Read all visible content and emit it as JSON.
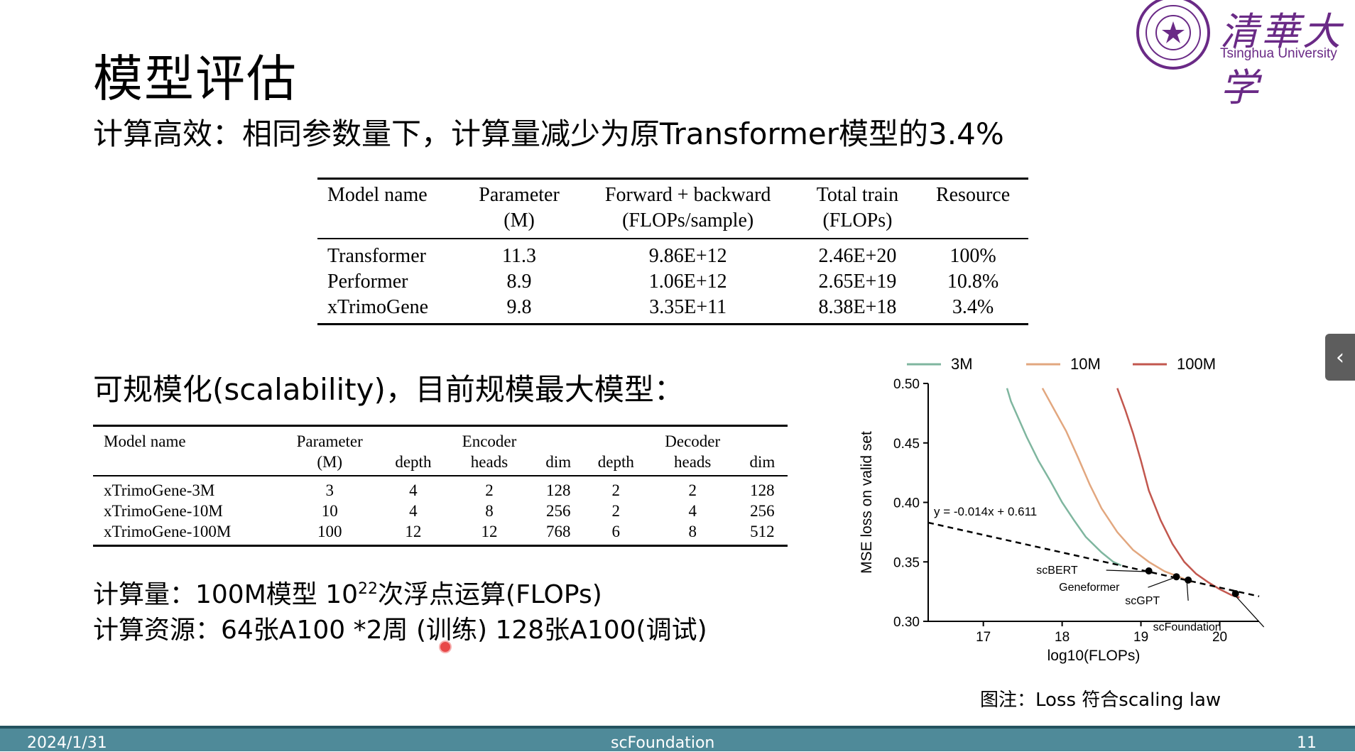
{
  "title": "模型评估",
  "subtitle": "计算高效：相同参数量下，计算量减少为原Transformer模型的3.4%",
  "section2": "可规模化(scalability)，目前规模最大模型：",
  "bullets": {
    "line1_prefix": "计算量：100M模型 10",
    "line1_sup": "22",
    "line1_suffix": "次浮点运算(FLOPs)",
    "line2": "计算资源：64张A100 *2周 (训练)   128张A100(调试)"
  },
  "logo": {
    "cn": "清華大学",
    "en": "Tsinghua University"
  },
  "table1": {
    "headers": [
      [
        "Model name",
        ""
      ],
      [
        "Parameter",
        "(M)"
      ],
      [
        "Forward + backward",
        "(FLOPs/sample)"
      ],
      [
        "Total train",
        "(FLOPs)"
      ],
      [
        "Resource",
        ""
      ]
    ],
    "rows": [
      [
        "Transformer",
        "11.3",
        "9.86E+12",
        "2.46E+20",
        "100%"
      ],
      [
        "Performer",
        "8.9",
        "1.06E+12",
        "2.65E+19",
        "10.8%"
      ],
      [
        "xTrimoGene",
        "9.8",
        "3.35E+11",
        "8.38E+18",
        "3.4%"
      ]
    ]
  },
  "table2": {
    "header_row1": [
      "Model name",
      "Parameter",
      "",
      "Encoder",
      "",
      "",
      "Decoder",
      ""
    ],
    "header_row2": [
      "",
      "(M)",
      "depth",
      "heads",
      "dim",
      "depth",
      "heads",
      "dim"
    ],
    "rows": [
      [
        "xTrimoGene-3M",
        "3",
        "4",
        "2",
        "128",
        "2",
        "2",
        "128"
      ],
      [
        "xTrimoGene-10M",
        "10",
        "4",
        "8",
        "256",
        "2",
        "4",
        "256"
      ],
      [
        "xTrimoGene-100M",
        "100",
        "12",
        "12",
        "768",
        "6",
        "8",
        "512"
      ]
    ]
  },
  "chart_data": {
    "type": "line",
    "xlabel": "log10(FLOPs)",
    "ylabel": "MSE loss on valid set",
    "xlim": [
      16.3,
      20.5
    ],
    "ylim": [
      0.3,
      0.5
    ],
    "xticks": [
      "17",
      "18",
      "19",
      "20"
    ],
    "yticks": [
      "0.30",
      "0.35",
      "0.40",
      "0.45",
      "0.50"
    ],
    "legend_position": "top",
    "series": [
      {
        "name": "3M",
        "color": "#7fb69f",
        "x": [
          17.3,
          17.35,
          17.45,
          17.55,
          17.7,
          17.85,
          18.0,
          18.15,
          18.3,
          18.5,
          18.65,
          18.75
        ],
        "y": [
          0.496,
          0.485,
          0.47,
          0.455,
          0.435,
          0.418,
          0.4,
          0.385,
          0.371,
          0.358,
          0.35,
          0.347
        ]
      },
      {
        "name": "10M",
        "color": "#e2a77f",
        "x": [
          17.75,
          17.9,
          18.05,
          18.2,
          18.35,
          18.5,
          18.7,
          18.9,
          19.1,
          19.3,
          19.5,
          19.65
        ],
        "y": [
          0.496,
          0.478,
          0.46,
          0.438,
          0.415,
          0.395,
          0.375,
          0.36,
          0.35,
          0.342,
          0.337,
          0.333
        ]
      },
      {
        "name": "100M",
        "color": "#c2574e",
        "x": [
          18.7,
          18.8,
          18.9,
          19.0,
          19.1,
          19.25,
          19.4,
          19.55,
          19.7,
          19.85,
          20.0,
          20.15,
          20.25
        ],
        "y": [
          0.496,
          0.478,
          0.458,
          0.435,
          0.41,
          0.385,
          0.365,
          0.35,
          0.34,
          0.333,
          0.327,
          0.322,
          0.32
        ]
      }
    ],
    "fit_line": {
      "label": "y = -0.014x + 0.611",
      "x": [
        16.3,
        20.5
      ],
      "y": [
        0.383,
        0.321
      ]
    },
    "points": [
      {
        "label": "scBERT",
        "x": 19.1,
        "y": 0.3424
      },
      {
        "label": "Geneformer",
        "x": 19.45,
        "y": 0.3375
      },
      {
        "label": "scGPT",
        "x": 19.6,
        "y": 0.3347
      },
      {
        "label": "scFoundation",
        "x": 20.2,
        "y": 0.3233
      }
    ]
  },
  "caption": "图注：Loss 符合scaling law",
  "footer": {
    "date": "2024/1/31",
    "center": "scFoundation",
    "page": "11"
  },
  "side_tab_icon": "chevron-left-icon"
}
